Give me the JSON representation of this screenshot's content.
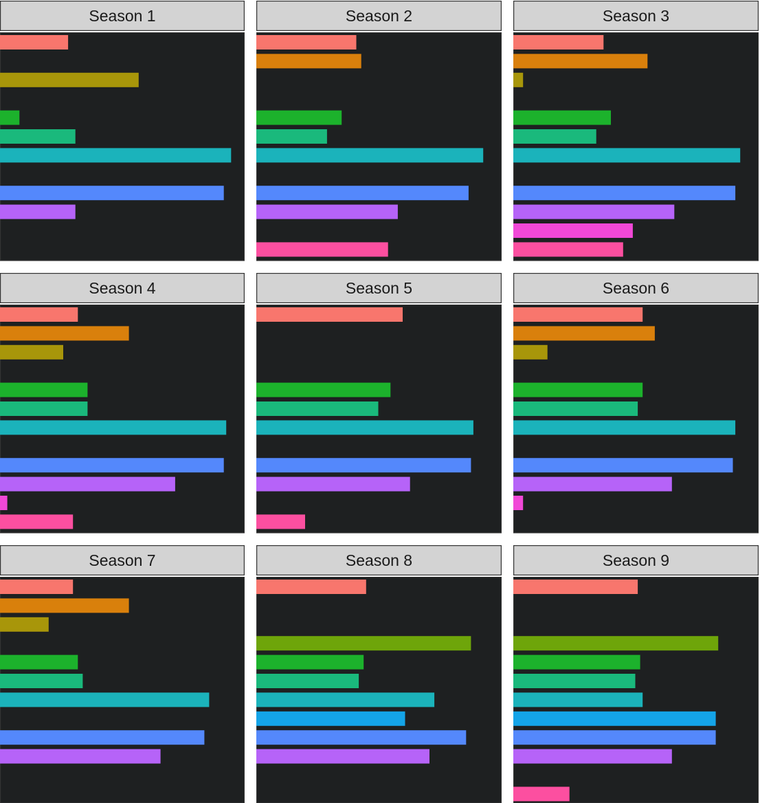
{
  "chart_data": {
    "type": "bar",
    "orientation": "horizontal",
    "facet_layout": "3x3 grid",
    "panel_background": "#1e2021",
    "strip_background": "#d3d3d3",
    "xlim": [
      0,
      100
    ],
    "slot_count": 12,
    "category_colors": [
      "#f8766d",
      "#d9800c",
      "#a8960a",
      "#6ea50a",
      "#1cb22c",
      "#1ab97c",
      "#1bb3bb",
      "#14a4e8",
      "#5488fc",
      "#b663f8",
      "#f148d7",
      "#fc4fa0"
    ],
    "panels": [
      {
        "label": "Season 1",
        "values": [
          28,
          0,
          57,
          0,
          8,
          31,
          95,
          0,
          92,
          31,
          0,
          0
        ]
      },
      {
        "label": "Season 2",
        "values": [
          41,
          43,
          0,
          0,
          35,
          29,
          93,
          0,
          87,
          58,
          0,
          54
        ]
      },
      {
        "label": "Season 3",
        "values": [
          37,
          55,
          4,
          0,
          40,
          34,
          93,
          0,
          91,
          66,
          49,
          45
        ]
      },
      {
        "label": "Season 4",
        "values": [
          32,
          53,
          26,
          0,
          36,
          36,
          93,
          0,
          92,
          72,
          3,
          30
        ]
      },
      {
        "label": "Season 5",
        "values": [
          60,
          0,
          0,
          0,
          55,
          50,
          89,
          0,
          88,
          63,
          0,
          20
        ]
      },
      {
        "label": "Season 6",
        "values": [
          53,
          58,
          14,
          0,
          53,
          51,
          91,
          0,
          90,
          65,
          4,
          0
        ]
      },
      {
        "label": "Season 7",
        "values": [
          30,
          53,
          20,
          0,
          32,
          34,
          86,
          0,
          84,
          66,
          0,
          0
        ]
      },
      {
        "label": "Season 8",
        "values": [
          45,
          0,
          0,
          88,
          44,
          42,
          73,
          61,
          86,
          71,
          0,
          0
        ]
      },
      {
        "label": "Season 9",
        "values": [
          51,
          0,
          0,
          84,
          52,
          50,
          53,
          83,
          83,
          65,
          0,
          23
        ]
      }
    ]
  }
}
